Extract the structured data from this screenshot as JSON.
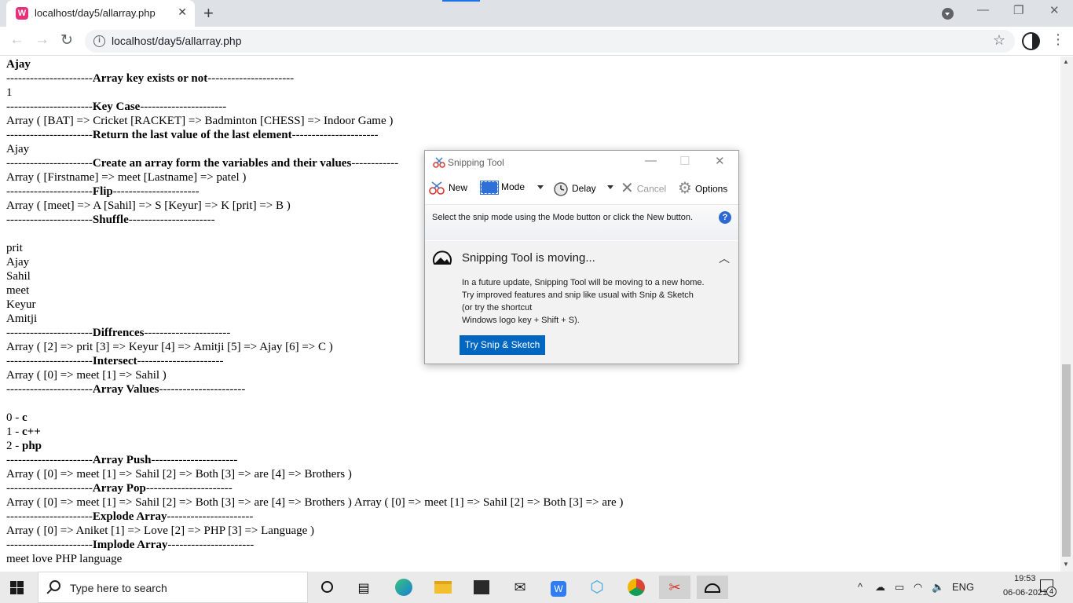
{
  "browser": {
    "tab_title": "localhost/day5/allarray.php",
    "tab_close": "✕",
    "new_tab": "+",
    "url": "localhost/day5/allarray.php",
    "favicon_letter": "W",
    "minimize": "—",
    "restore": "❐",
    "close": "✕",
    "back": "←",
    "forward": "→",
    "reload": "↻",
    "info": "i",
    "star": "☆",
    "menu": "⋮"
  },
  "page": {
    "lines": [
      {
        "pre": "",
        "bold": "Ajay",
        "post": ""
      },
      {
        "pre": "----------------------",
        "bold": "Array key exists or not",
        "post": "----------------------"
      },
      {
        "pre": "1",
        "bold": "",
        "post": ""
      },
      {
        "pre": "----------------------",
        "bold": "Key Case",
        "post": "----------------------"
      },
      {
        "pre": "Array ( [BAT] => Cricket [RACKET] => Badminton [CHESS] => Indoor Game )",
        "bold": "",
        "post": ""
      },
      {
        "pre": "----------------------",
        "bold": "Return the last value of the last element",
        "post": "----------------------"
      },
      {
        "pre": "Ajay",
        "bold": "",
        "post": ""
      },
      {
        "pre": "----------------------",
        "bold": "Create an array form the variables and their values",
        "post": "------------"
      },
      {
        "pre": "Array ( [Firstname] => meet [Lastname] => patel )",
        "bold": "",
        "post": ""
      },
      {
        "pre": "----------------------",
        "bold": "Flip",
        "post": "----------------------"
      },
      {
        "pre": "Array ( [meet] => A [Sahil] => S [Keyur] => K [prit] => B )",
        "bold": "",
        "post": ""
      },
      {
        "pre": "----------------------",
        "bold": "Shuffle",
        "post": "----------------------"
      },
      {
        "pre": "",
        "bold": "",
        "post": ""
      },
      {
        "pre": "prit",
        "bold": "",
        "post": ""
      },
      {
        "pre": "Ajay",
        "bold": "",
        "post": ""
      },
      {
        "pre": "Sahil",
        "bold": "",
        "post": ""
      },
      {
        "pre": "meet",
        "bold": "",
        "post": ""
      },
      {
        "pre": "Keyur",
        "bold": "",
        "post": ""
      },
      {
        "pre": "Amitji",
        "bold": "",
        "post": ""
      },
      {
        "pre": "----------------------",
        "bold": "Diffrences",
        "post": "----------------------"
      },
      {
        "pre": "Array ( [2] => prit [3] => Keyur [4] => Amitji [5] => Ajay [6] => C )",
        "bold": "",
        "post": ""
      },
      {
        "pre": "----------------------",
        "bold": "Intersect",
        "post": "----------------------"
      },
      {
        "pre": "Array ( [0] => meet [1] => Sahil )",
        "bold": "",
        "post": ""
      },
      {
        "pre": "----------------------",
        "bold": "Array Values",
        "post": "----------------------"
      },
      {
        "pre": "",
        "bold": "",
        "post": ""
      },
      {
        "pre": "0 - ",
        "bold": "c",
        "post": ""
      },
      {
        "pre": "1 - ",
        "bold": "c++",
        "post": ""
      },
      {
        "pre": "2 - ",
        "bold": "php",
        "post": ""
      },
      {
        "pre": "----------------------",
        "bold": "Array Push",
        "post": "----------------------"
      },
      {
        "pre": "Array ( [0] => meet [1] => Sahil [2] => Both [3] => are [4] => Brothers )",
        "bold": "",
        "post": ""
      },
      {
        "pre": "----------------------",
        "bold": "Array Pop",
        "post": "----------------------"
      },
      {
        "pre": "Array ( [0] => meet [1] => Sahil [2] => Both [3] => are [4] => Brothers ) Array ( [0] => meet [1] => Sahil [2] => Both [3] => are )",
        "bold": "",
        "post": ""
      },
      {
        "pre": "----------------------",
        "bold": "Explode Array",
        "post": "----------------------"
      },
      {
        "pre": "Array ( [0] => Aniket [1] => Love [2] => PHP [3] => Language )",
        "bold": "",
        "post": ""
      },
      {
        "pre": "----------------------",
        "bold": "Implode Array",
        "post": "----------------------"
      },
      {
        "pre": "meet love PHP language",
        "bold": "",
        "post": ""
      }
    ]
  },
  "snipping_tool": {
    "title": "Snipping Tool",
    "minimize": "—",
    "maximize": "☐",
    "close": "✕",
    "toolbar": {
      "new": "New",
      "mode": "Mode",
      "delay": "Delay",
      "cancel": "Cancel",
      "options": "Options"
    },
    "help_text": "Select the snip mode using the Mode button or click the New button.",
    "help_icon": "?",
    "moving_title": "Snipping Tool is moving...",
    "moving_chevron": "︿",
    "moving_body_1": "In a future update, Snipping Tool will be moving to a new home. Try improved features and snip like usual with Snip & Sketch (or try the shortcut",
    "moving_body_2": "Windows logo key + Shift + S).",
    "try_button": "Try Snip & Sketch"
  },
  "taskbar": {
    "search_placeholder": "Type here to search",
    "language": "ENG",
    "time": "19:53",
    "date": "06-06-2021",
    "notification_count": "4",
    "tray_chevron": "^",
    "apps": [
      "cortana",
      "task-view",
      "edge",
      "file-explorer",
      "store",
      "mail",
      "wps",
      "app-cube",
      "chrome",
      "snipping-tool",
      "snip-sketch"
    ]
  },
  "colors": {
    "accent": "#1a73e8",
    "snip_button": "#0067c0",
    "favicon": "#e8307a"
  }
}
